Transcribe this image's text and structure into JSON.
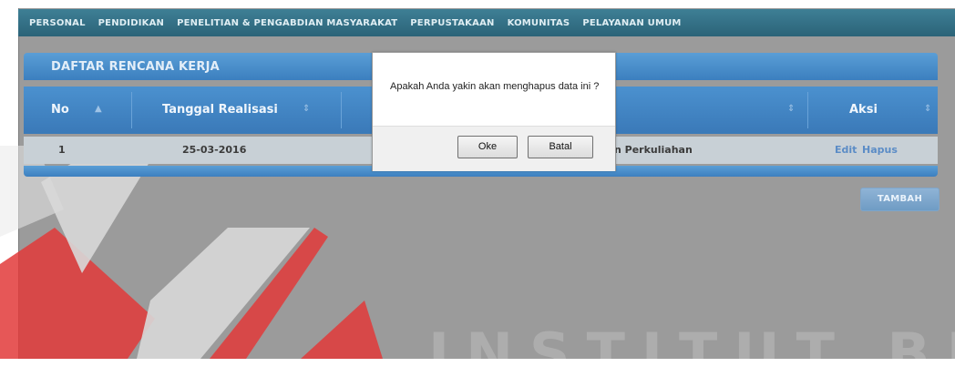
{
  "nav": {
    "items": [
      "PERSONAL",
      "PENDIDIKAN",
      "PENELITIAN & PENGABDIAN MASYARAKAT",
      "PERPUSTAKAAN",
      "KOMUNITAS",
      "PELAYANAN UMUM"
    ]
  },
  "panel": {
    "title": "DAFTAR RENCANA KERJA"
  },
  "table": {
    "headers": {
      "no": "No",
      "tanggal": "Tanggal Realisasi",
      "aksi": "Aksi"
    },
    "rows": [
      {
        "no": "1",
        "tanggal": "25-03-2016",
        "kegiatan": "n Perkuliahan",
        "edit": "Edit",
        "hapus": "Hapus"
      }
    ]
  },
  "actions": {
    "add_label": "TAMBAH"
  },
  "dialog": {
    "message": "Apakah Anda yakin akan menghapus data ini ?",
    "ok_label": "Oke",
    "cancel_label": "Batal"
  },
  "watermark": {
    "text": "INSTITUT BISNIS"
  },
  "colors": {
    "nav_bg": "#2b6378",
    "header_blue": "#3c7fbf",
    "overlay": "#9b9b9b",
    "watermark_red": "#e23a3a",
    "link": "#5b8cc6"
  }
}
